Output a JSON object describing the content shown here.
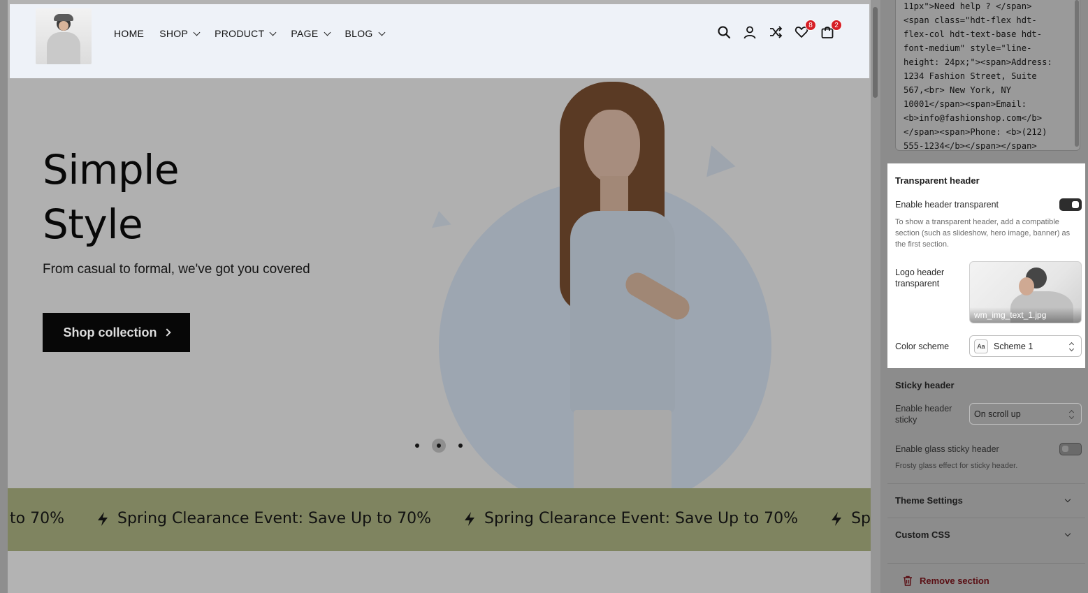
{
  "header": {
    "nav": [
      {
        "label": "HOME",
        "dropdown": false
      },
      {
        "label": "SHOP",
        "dropdown": true
      },
      {
        "label": "PRODUCT",
        "dropdown": true
      },
      {
        "label": "PAGE",
        "dropdown": true
      },
      {
        "label": "BLOG",
        "dropdown": true
      }
    ],
    "icons": [
      "search-icon",
      "account-icon",
      "compare-icon",
      "wishlist-icon",
      "cart-icon"
    ],
    "wishlist_count": "8",
    "cart_count": "2"
  },
  "hero": {
    "title_line1": "Simple",
    "title_line2": "Style",
    "subtitle": "From casual to formal, we've got you covered",
    "button_label": "Shop collection",
    "slides": 3,
    "active_slide": 2
  },
  "ticker": {
    "first_fragment": "to 70%",
    "text": "Spring Clearance Event: Save Up to 70%",
    "last_fragment": "Spr"
  },
  "sidebar": {
    "code_text": "11px\">Need help ? </span>\n<span class=\"hdt-flex hdt-\nflex-col hdt-text-base hdt-\nfont-medium\" style=\"line-\nheight: 24px;\"><span>Address:\n1234 Fashion Street, Suite\n567,<br> New York, NY\n10001</span><span>Email:\n<b>info@fashionshop.com</b>\n</span><span>Phone: <b>(212)\n555-1234</b></span></span>",
    "transparent": {
      "title": "Transparent header",
      "enable_label": "Enable header transparent",
      "enabled": true,
      "help": "To show a transparent header, add a compatible section (such as slideshow, hero image, banner) as the first section.",
      "logo_label": "Logo header transparent",
      "logo_file": "wm_img_text_1.jpg",
      "color_scheme_label": "Color scheme",
      "color_scheme_icon": "Aa",
      "color_scheme_value": "Scheme 1"
    },
    "sticky": {
      "title": "Sticky header",
      "enable_label": "Enable header sticky",
      "enable_value": "On scroll up",
      "glass_label": "Enable glass sticky header",
      "glass_enabled": false,
      "glass_help": "Frosty glass effect for sticky header."
    },
    "accordions": [
      "Theme Settings",
      "Custom CSS"
    ],
    "remove_label": "Remove section"
  },
  "colors": {
    "header_bg": "#eef2f8",
    "ticker_bg": "#7f8460",
    "badge": "#d61f26",
    "remove_text": "#5a0f14"
  }
}
